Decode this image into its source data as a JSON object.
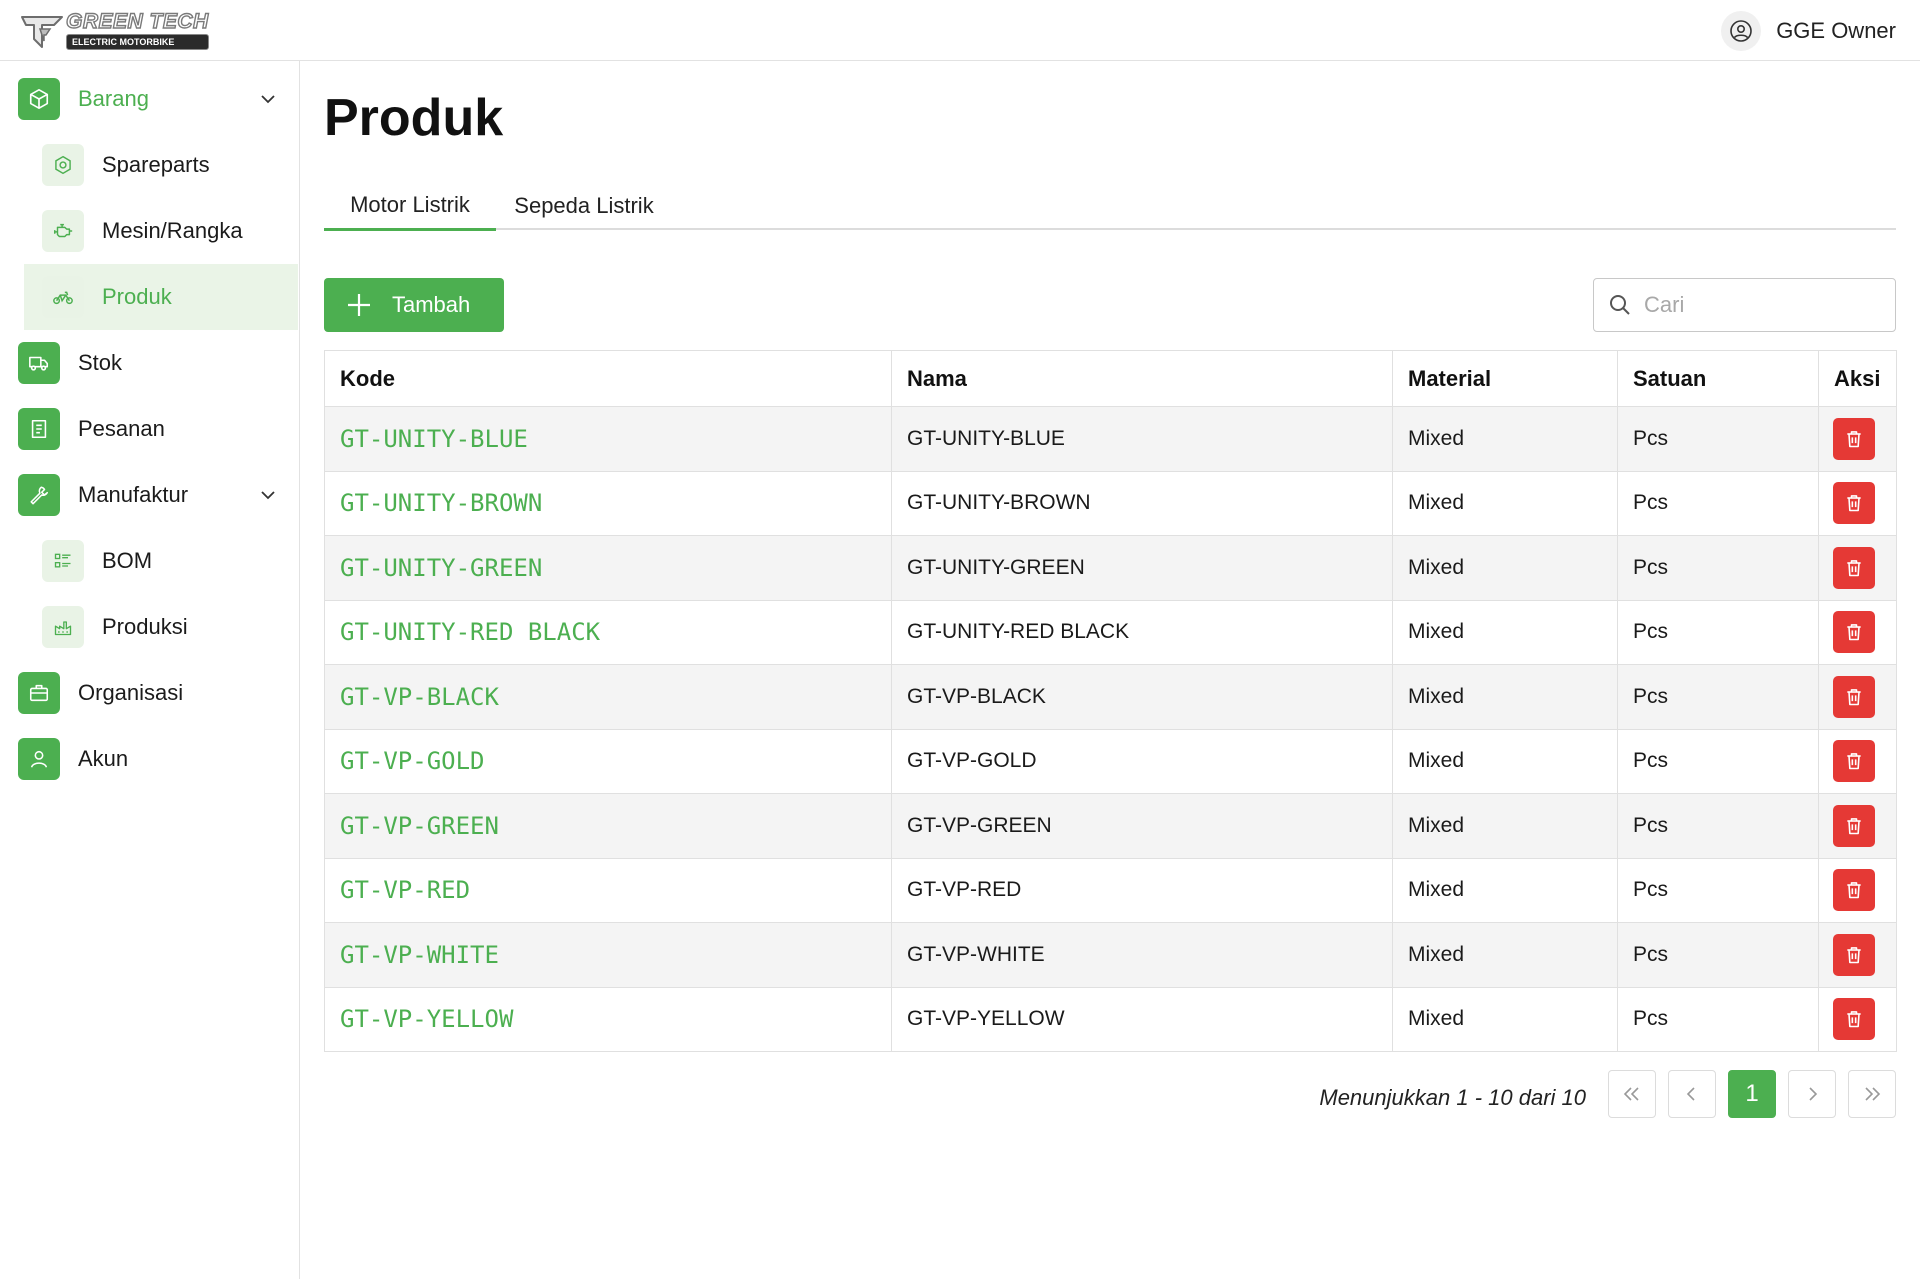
{
  "header": {
    "logo_title": "GREEN TECH",
    "logo_subtitle": "ELECTRIC MOTORBIKE",
    "user_name": "GGE Owner"
  },
  "sidebar": {
    "items": [
      {
        "label": "Barang",
        "icon": "box-icon"
      },
      {
        "label": "Spareparts",
        "icon": "gear-icon"
      },
      {
        "label": "Mesin/Rangka",
        "icon": "engine-icon"
      },
      {
        "label": "Produk",
        "icon": "motorbike-icon"
      },
      {
        "label": "Stok",
        "icon": "truck-icon"
      },
      {
        "label": "Pesanan",
        "icon": "receipt-icon"
      },
      {
        "label": "Manufaktur",
        "icon": "wrench-icon"
      },
      {
        "label": "BOM",
        "icon": "list-icon"
      },
      {
        "label": "Produksi",
        "icon": "factory-icon"
      },
      {
        "label": "Organisasi",
        "icon": "briefcase-icon"
      },
      {
        "label": "Akun",
        "icon": "user-icon"
      }
    ]
  },
  "main": {
    "title": "Produk",
    "tabs": [
      {
        "label": "Motor Listrik",
        "active": true
      },
      {
        "label": "Sepeda Listrik",
        "active": false
      }
    ],
    "add_label": "Tambah",
    "search_placeholder": "Cari"
  },
  "table": {
    "columns": [
      "Kode",
      "Nama",
      "Material",
      "Satuan",
      "Aksi"
    ],
    "rows": [
      {
        "kode": "GT-UNITY-BLUE",
        "nama": "GT-UNITY-BLUE",
        "material": "Mixed",
        "satuan": "Pcs"
      },
      {
        "kode": "GT-UNITY-BROWN",
        "nama": "GT-UNITY-BROWN",
        "material": "Mixed",
        "satuan": "Pcs"
      },
      {
        "kode": "GT-UNITY-GREEN",
        "nama": "GT-UNITY-GREEN",
        "material": "Mixed",
        "satuan": "Pcs"
      },
      {
        "kode": "GT-UNITY-RED BLACK",
        "nama": "GT-UNITY-RED BLACK",
        "material": "Mixed",
        "satuan": "Pcs"
      },
      {
        "kode": "GT-VP-BLACK",
        "nama": "GT-VP-BLACK",
        "material": "Mixed",
        "satuan": "Pcs"
      },
      {
        "kode": "GT-VP-GOLD",
        "nama": "GT-VP-GOLD",
        "material": "Mixed",
        "satuan": "Pcs"
      },
      {
        "kode": "GT-VP-GREEN",
        "nama": "GT-VP-GREEN",
        "material": "Mixed",
        "satuan": "Pcs"
      },
      {
        "kode": "GT-VP-RED",
        "nama": "GT-VP-RED",
        "material": "Mixed",
        "satuan": "Pcs"
      },
      {
        "kode": "GT-VP-WHITE",
        "nama": "GT-VP-WHITE",
        "material": "Mixed",
        "satuan": "Pcs"
      },
      {
        "kode": "GT-VP-YELLOW",
        "nama": "GT-VP-YELLOW",
        "material": "Mixed",
        "satuan": "Pcs"
      }
    ]
  },
  "pagination": {
    "info": "Menunjukkan 1 - 10 dari 10",
    "current_page": "1"
  },
  "colors": {
    "accent": "#4caf50",
    "danger": "#e53935"
  }
}
